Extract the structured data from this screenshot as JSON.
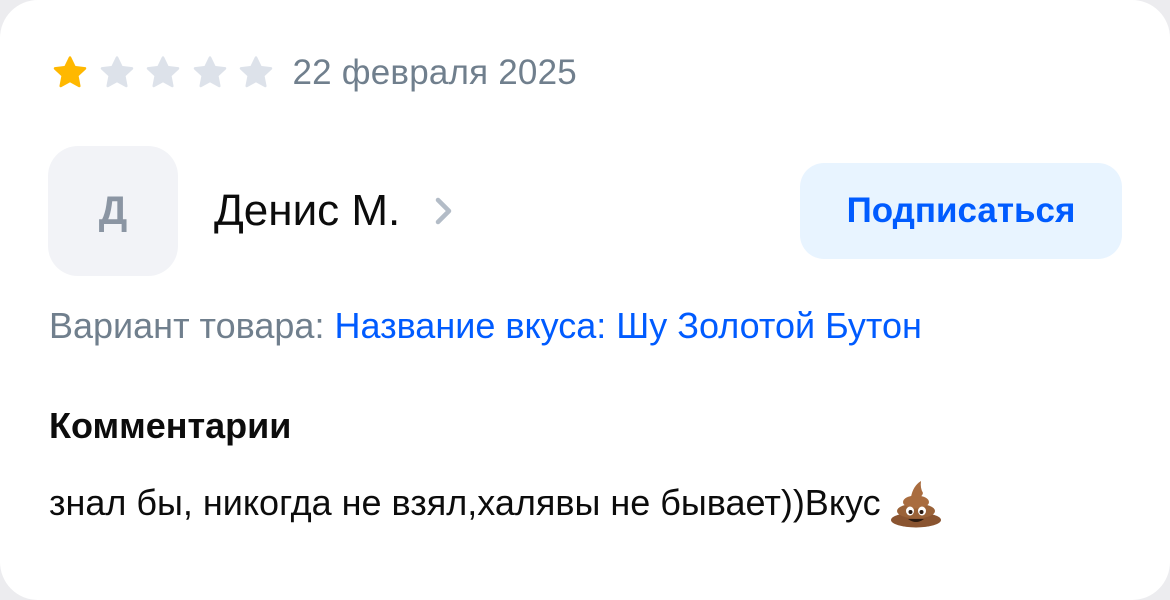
{
  "review": {
    "rating": 1,
    "max_rating": 5,
    "date": "22 февраля 2025",
    "colors": {
      "star_filled": "#ffb800",
      "star_empty": "#dde2ea",
      "accent": "#005bff",
      "muted_text": "#707f8d"
    },
    "author": {
      "initial": "Д",
      "name": "Денис М.",
      "subscribe_label": "Подписаться"
    },
    "variant": {
      "label": "Вариант товара:",
      "value": "Название вкуса: Шу Золотой Бутон"
    },
    "comments": {
      "heading": "Комментарии",
      "text": "знал бы, никогда не взял,халявы не бывает))Вкус",
      "trailing_emoji_icon": "pile-of-poo-icon"
    }
  }
}
